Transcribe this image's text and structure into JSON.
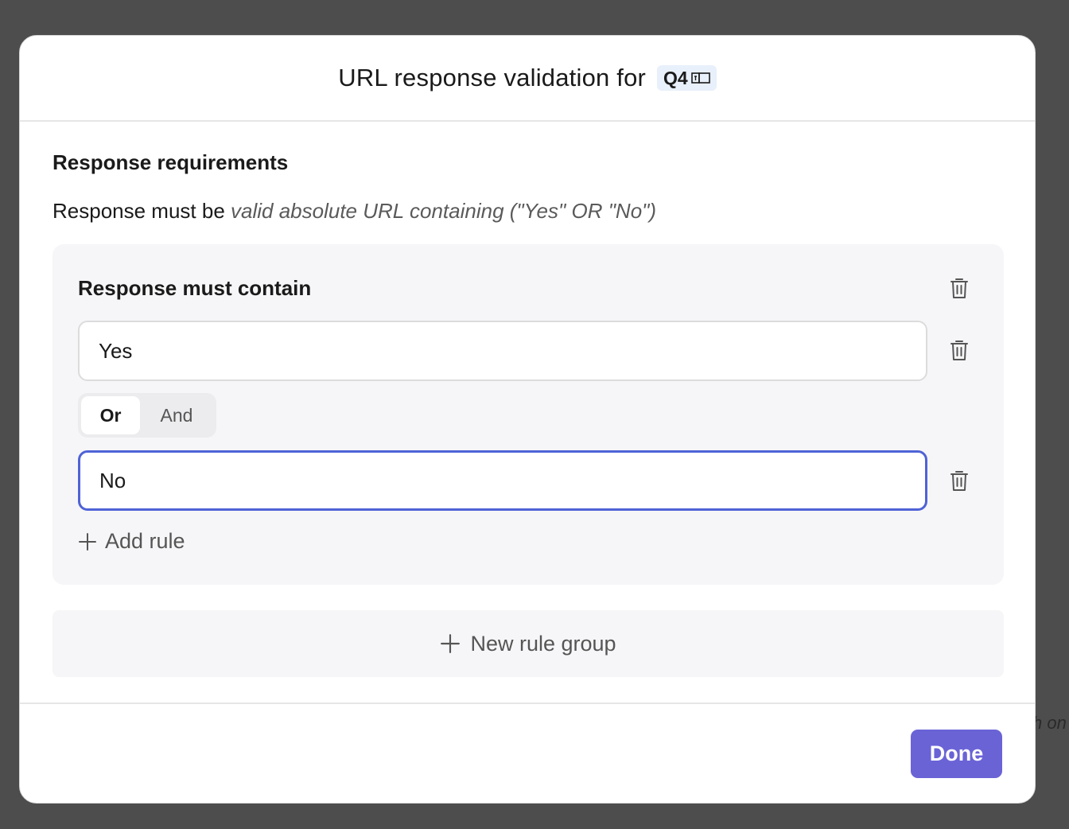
{
  "backdrop": {
    "partial_text": "h on"
  },
  "modal": {
    "title": "URL response validation for",
    "question_badge": "Q4",
    "badge_icon": "variable-icon"
  },
  "requirements": {
    "section_title": "Response requirements",
    "summary_prefix": "Response must be ",
    "summary_rule": "valid absolute URL containing (\"Yes\" OR \"No\")"
  },
  "rule_group": {
    "title": "Response must contain",
    "rules": [
      {
        "value": "Yes"
      },
      {
        "value": "No"
      }
    ],
    "operator": {
      "options": [
        "Or",
        "And"
      ],
      "selected": "Or"
    },
    "add_rule_label": "Add rule"
  },
  "new_rule_group_label": "New rule group",
  "footer": {
    "done_label": "Done"
  },
  "colors": {
    "accent": "#6a63d6",
    "focus_border": "#4f63d6",
    "badge_bg": "#e8f0fb"
  }
}
